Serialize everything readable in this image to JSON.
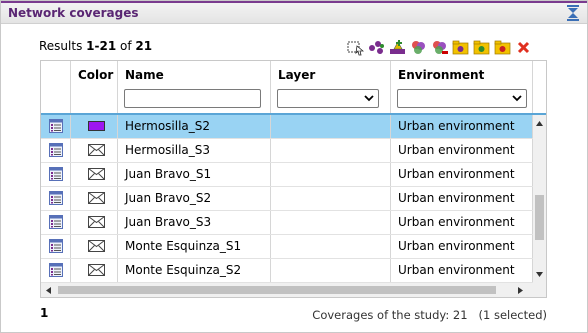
{
  "panel": {
    "title": "Network coverages"
  },
  "results": {
    "prefix": "Results ",
    "range": "1-21",
    "of": " of ",
    "total": "21"
  },
  "toolbar": {
    "icons": [
      "select-area-icon",
      "network-nodes-icon",
      "add-coverage-icon",
      "coverage-group-icon",
      "coverage-group-remove-icon",
      "folder-yellow-icon",
      "folder-green-icon",
      "folder-red-icon",
      "delete-icon"
    ]
  },
  "grid": {
    "columns": {
      "color": "Color",
      "name": "Name",
      "layer": "Layer",
      "environment": "Environment"
    },
    "filters": {
      "name": "",
      "layer": "",
      "environment": ""
    },
    "rows": [
      {
        "name": "Hermosilla_S2",
        "layer": "",
        "environment": "Urban environment",
        "selected": true,
        "color": "#9d16f0"
      },
      {
        "name": "Hermosilla_S3",
        "layer": "",
        "environment": "Urban environment",
        "selected": false,
        "color": ""
      },
      {
        "name": "Juan Bravo_S1",
        "layer": "",
        "environment": "Urban environment",
        "selected": false,
        "color": ""
      },
      {
        "name": "Juan Bravo_S2",
        "layer": "",
        "environment": "Urban environment",
        "selected": false,
        "color": ""
      },
      {
        "name": "Juan Bravo_S3",
        "layer": "",
        "environment": "Urban environment",
        "selected": false,
        "color": ""
      },
      {
        "name": "Monte Esquinza_S1",
        "layer": "",
        "environment": "Urban environment",
        "selected": false,
        "color": ""
      },
      {
        "name": "Monte Esquinza_S2",
        "layer": "",
        "environment": "Urban environment",
        "selected": false,
        "color": ""
      }
    ]
  },
  "pager": {
    "current_page": "1"
  },
  "footer": {
    "status": "Coverages of the study: 21   (1 selected)"
  }
}
